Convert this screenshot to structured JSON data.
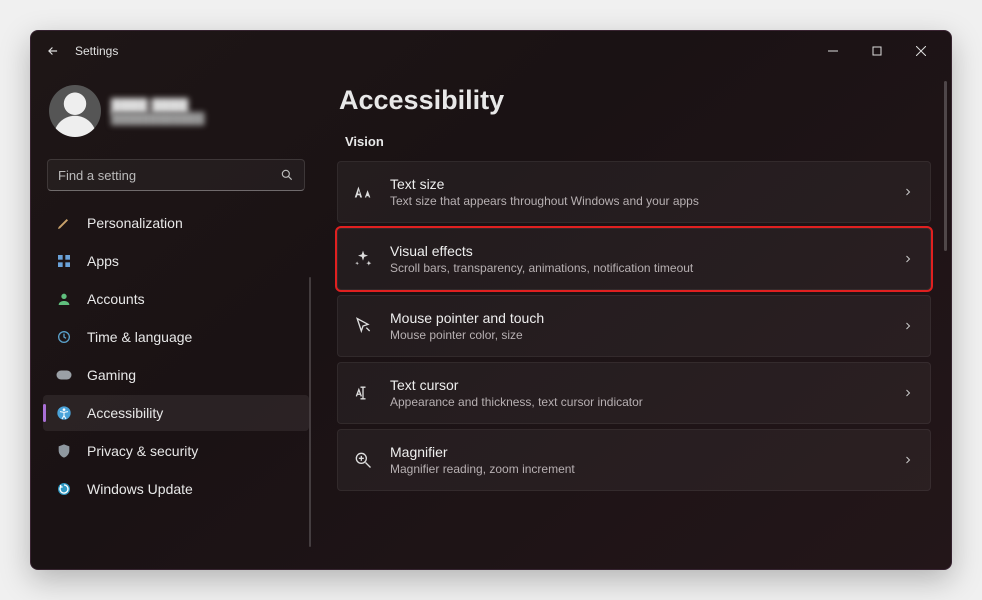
{
  "titlebar": {
    "title": "Settings"
  },
  "profile": {
    "name": "████ ████",
    "email": "████████████"
  },
  "search": {
    "placeholder": "Find a setting"
  },
  "sidebar": {
    "items": [
      {
        "label": "Personalization",
        "icon": "paintbrush-icon"
      },
      {
        "label": "Apps",
        "icon": "apps-icon"
      },
      {
        "label": "Accounts",
        "icon": "person-icon"
      },
      {
        "label": "Time & language",
        "icon": "globe-clock-icon"
      },
      {
        "label": "Gaming",
        "icon": "gamepad-icon"
      },
      {
        "label": "Accessibility",
        "icon": "accessibility-icon",
        "active": true
      },
      {
        "label": "Privacy & security",
        "icon": "shield-icon"
      },
      {
        "label": "Windows Update",
        "icon": "update-icon"
      }
    ]
  },
  "page": {
    "heading": "Accessibility",
    "section": "Vision",
    "cards": [
      {
        "title": "Text size",
        "subtitle": "Text size that appears throughout Windows and your apps",
        "icon": "text-size-icon"
      },
      {
        "title": "Visual effects",
        "subtitle": "Scroll bars, transparency, animations, notification timeout",
        "icon": "sparkle-icon",
        "highlighted": true
      },
      {
        "title": "Mouse pointer and touch",
        "subtitle": "Mouse pointer color, size",
        "icon": "cursor-icon"
      },
      {
        "title": "Text cursor",
        "subtitle": "Appearance and thickness, text cursor indicator",
        "icon": "text-cursor-icon"
      },
      {
        "title": "Magnifier",
        "subtitle": "Magnifier reading, zoom increment",
        "icon": "magnifier-icon"
      }
    ]
  }
}
